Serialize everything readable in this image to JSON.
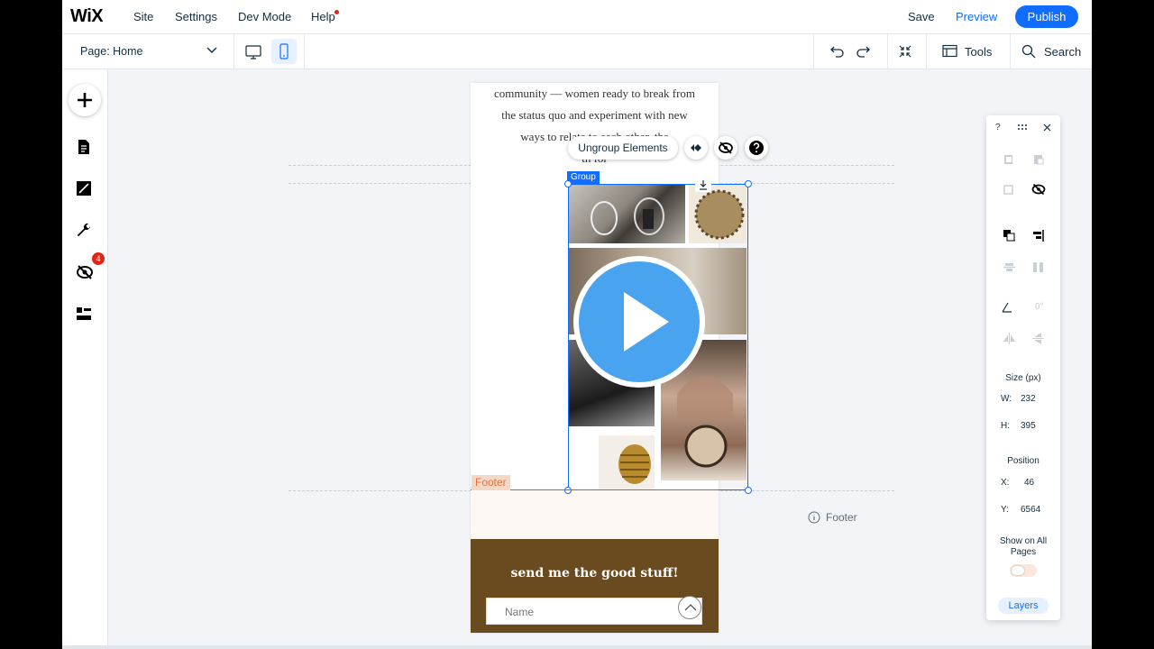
{
  "topbar": {
    "logo": "WiX",
    "menu": [
      "Site",
      "Settings",
      "Dev Mode",
      "Help"
    ],
    "save": "Save",
    "preview": "Preview",
    "publish": "Publish"
  },
  "subbar": {
    "page_label": "Page:",
    "page_value": "Home",
    "tools": "Tools",
    "search": "Search"
  },
  "sidebar": {
    "hidden_badge": "4"
  },
  "page": {
    "body_lines": [
      "community — women ready to break from",
      "the status quo and experiment with new",
      "ways to relate to each other, the",
      "th   for"
    ],
    "footer_title": "send me the good stuff!",
    "name_placeholder": "Name"
  },
  "selection": {
    "ungroup_label": "Ungroup Elements",
    "group_tag": "Group",
    "footer_tag": "Footer",
    "footer_info": "Footer"
  },
  "panel": {
    "help": "?",
    "angle": "0°",
    "size_label": "Size (px)",
    "w_label": "W:",
    "w_value": "232",
    "h_label": "H:",
    "h_value": "395",
    "position_label": "Position",
    "x_label": "X:",
    "x_value": "46",
    "y_label": "Y:",
    "y_value": "6564",
    "show_all_pages": "Show on All Pages",
    "layers": "Layers"
  },
  "colors": {
    "accent": "#116dff",
    "footer_brown": "#6a4a1f",
    "play_blue": "#4aa3ee"
  }
}
